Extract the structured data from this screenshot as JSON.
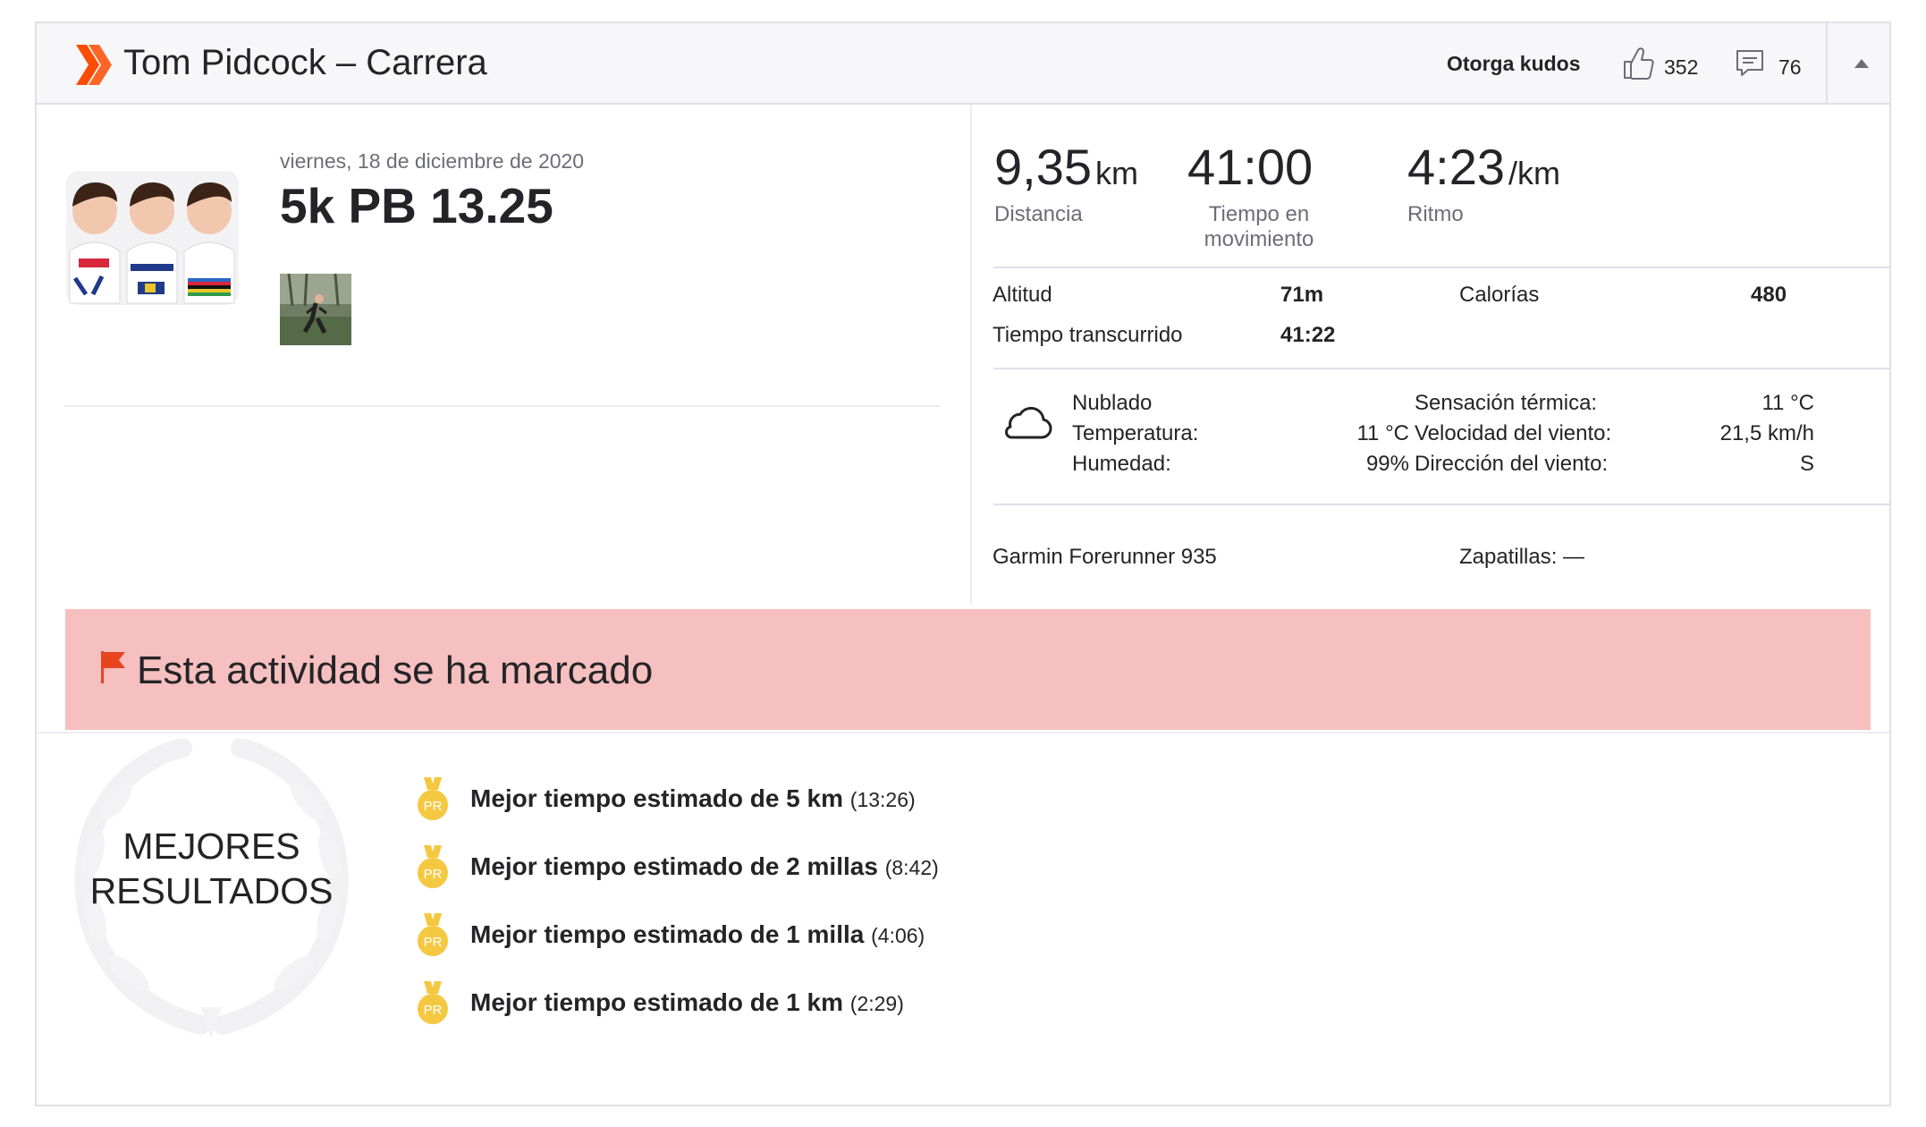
{
  "header": {
    "title": "Tom Pidcock – Carrera",
    "kudos_label": "Otorga kudos",
    "kudos_count": "352",
    "comment_count": "76",
    "brand_color": "#fc4c02"
  },
  "activity": {
    "date": "viernes, 18 de diciembre de 2020",
    "name": "5k PB 13.25"
  },
  "stats": {
    "distance_value": "9,35",
    "distance_unit": "km",
    "distance_label": "Distancia",
    "moving_time_value": "41:00",
    "moving_time_label": "Tiempo en movimiento",
    "pace_value": "4:23",
    "pace_unit": "/km",
    "pace_label": "Ritmo"
  },
  "details": {
    "elevation_label": "Altitud",
    "elevation_value": "71m",
    "calories_label": "Calorías",
    "calories_value": "480",
    "elapsed_label": "Tiempo transcurrido",
    "elapsed_value": "41:22"
  },
  "weather": {
    "condition": "Nublado",
    "temperature_label": "Temperatura:",
    "temperature_value": "11 °C",
    "humidity_label": "Humedad:",
    "humidity_value": "99%",
    "feels_like_label": "Sensación térmica:",
    "feels_like_value": "11 °C",
    "wind_speed_label": "Velocidad del viento:",
    "wind_speed_value": "21,5 km/h",
    "wind_dir_label": "Dirección del viento:",
    "wind_dir_value": "S"
  },
  "gear": {
    "device": "Garmin Forerunner 935",
    "shoes": "Zapatillas: —"
  },
  "flag": {
    "text": "Esta actividad se ha marcado",
    "banner_color": "#f5c0bf"
  },
  "best_efforts": {
    "title_line1": "MEJORES",
    "title_line2": "RESULTADOS",
    "medal_label": "PR",
    "items": [
      {
        "name": "Mejor tiempo estimado de 5 km",
        "time": "(13:26)"
      },
      {
        "name": "Mejor tiempo estimado de 2 millas",
        "time": "(8:42)"
      },
      {
        "name": "Mejor tiempo estimado de 1 milla",
        "time": "(4:06)"
      },
      {
        "name": "Mejor tiempo estimado de 1 km",
        "time": "(2:29)"
      }
    ]
  }
}
